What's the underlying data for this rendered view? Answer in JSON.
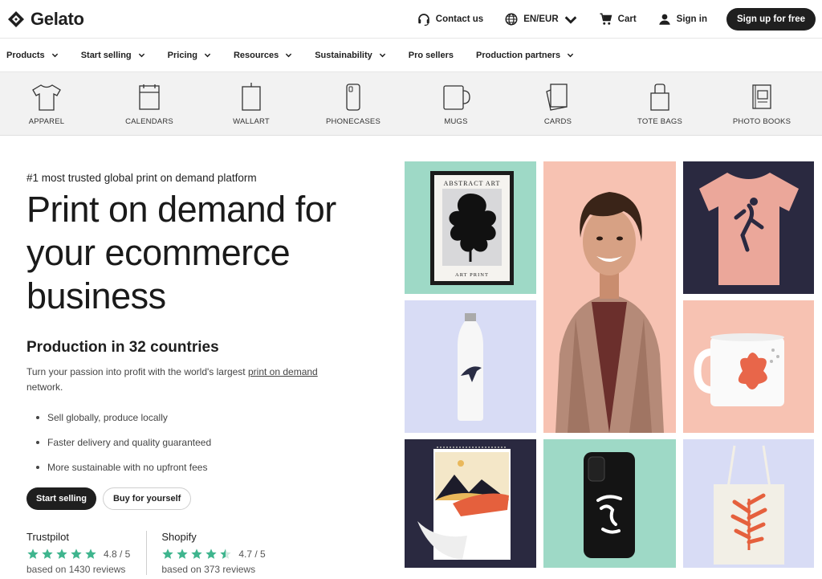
{
  "brand": {
    "name": "Gelato"
  },
  "topbar": {
    "contact": "Contact us",
    "locale": "EN/EUR",
    "cart": "Cart",
    "signin": "Sign in",
    "signup": "Sign up for free"
  },
  "nav": [
    {
      "label": "Products"
    },
    {
      "label": "Start selling"
    },
    {
      "label": "Pricing"
    },
    {
      "label": "Resources"
    },
    {
      "label": "Sustainability"
    },
    {
      "label": "Pro sellers"
    },
    {
      "label": "Production partners"
    }
  ],
  "categories": [
    {
      "label": "APPAREL",
      "icon": "tshirt-icon"
    },
    {
      "label": "CALENDARS",
      "icon": "calendar-icon"
    },
    {
      "label": "WALLART",
      "icon": "wallart-icon"
    },
    {
      "label": "PHONECASES",
      "icon": "phonecase-icon"
    },
    {
      "label": "MUGS",
      "icon": "mug-icon"
    },
    {
      "label": "CARDS",
      "icon": "card-icon"
    },
    {
      "label": "TOTE BAGS",
      "icon": "tote-bag-icon"
    },
    {
      "label": "PHOTO BOOKS",
      "icon": "photo-book-icon"
    }
  ],
  "hero": {
    "eyebrow": "#1 most trusted global print on demand platform",
    "headline": "Print on demand for your ecommerce business",
    "subhead": "Production in 32 countries",
    "desc_pre": "Turn your passion into profit with the world's largest ",
    "desc_link": "print on demand",
    "desc_post": " network.",
    "bullets": [
      "Sell globally, produce locally",
      "Faster delivery and quality guaranteed",
      "More sustainable with no upfront fees"
    ],
    "cta_primary": "Start selling",
    "cta_secondary": "Buy for yourself"
  },
  "reviews": [
    {
      "source": "Trustpilot",
      "score": "4.8 / 5",
      "stars": 5,
      "count": "based on 1430 reviews"
    },
    {
      "source": "Shopify",
      "score": "4.7 / 5",
      "stars": 4.5,
      "count": "based on 373 reviews"
    }
  ],
  "gallery": {
    "poster_title": "ABSTRACT ART",
    "poster_caption": "ART PRINT"
  },
  "colors": {
    "dark": "#1f1f1f",
    "star": "#3fb58e",
    "mint": "#9ed9c6",
    "peach": "#f7c2b2",
    "navy": "#2a2940",
    "lavender": "#d8dcf5"
  }
}
